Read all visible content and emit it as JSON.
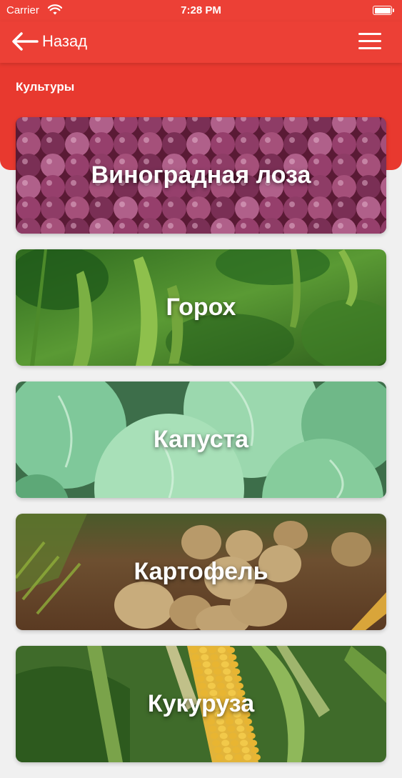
{
  "status_bar": {
    "carrier": "Carrier",
    "time": "7:28 PM"
  },
  "nav": {
    "back_label": "Назад",
    "back_icon": "arrow-left-icon",
    "menu_icon": "hamburger-menu-icon"
  },
  "section": {
    "title": "Культуры"
  },
  "crops": [
    {
      "name": "Виноградная лоза",
      "image": "grapes-photo"
    },
    {
      "name": "Горох",
      "image": "peas-photo"
    },
    {
      "name": "Капуста",
      "image": "cabbage-photo"
    },
    {
      "name": "Картофель",
      "image": "potatoes-photo"
    },
    {
      "name": "Кукуруза",
      "image": "corn-photo"
    }
  ],
  "colors": {
    "header_red": "#ec4036",
    "panel_red": "#e8392f",
    "background": "#f0f0f0"
  }
}
